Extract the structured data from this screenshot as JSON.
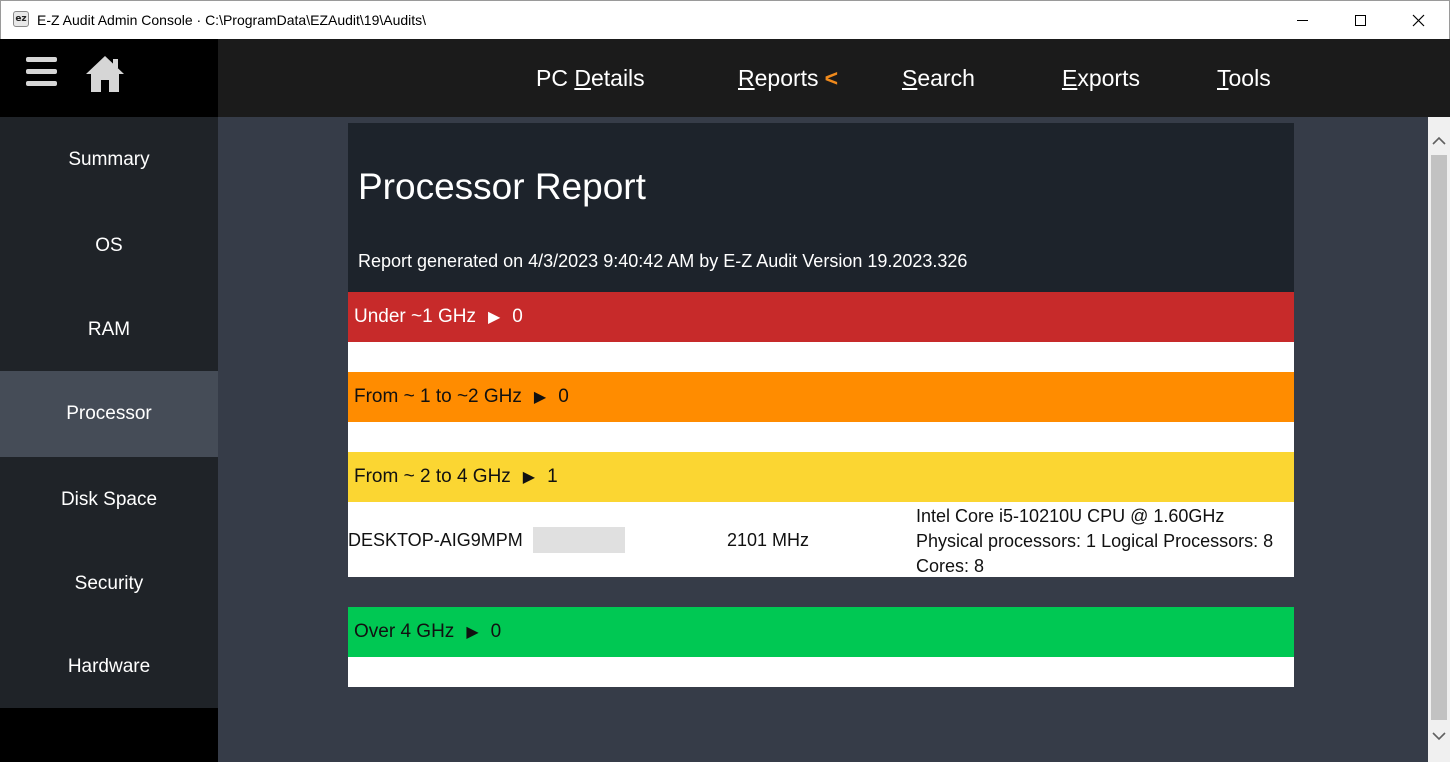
{
  "window": {
    "title": "E-Z Audit Admin Console · C:\\ProgramData\\EZAudit\\19\\Audits\\",
    "app_icon_text": "ez"
  },
  "topnav": {
    "items": [
      {
        "pre": "PC ",
        "key": "D",
        "post": "etails"
      },
      {
        "pre": "",
        "key": "R",
        "post": "eports",
        "active": true
      },
      {
        "pre": "",
        "key": "S",
        "post": "earch"
      },
      {
        "pre": "",
        "key": "E",
        "post": "xports"
      },
      {
        "pre": "",
        "key": "T",
        "post": "ools"
      }
    ],
    "active_arrow": "<",
    "accent_color": "#f08a1c"
  },
  "sidebar": {
    "items": [
      {
        "label": "Summary"
      },
      {
        "label": "OS"
      },
      {
        "label": "RAM"
      },
      {
        "label": "Processor",
        "active": true
      },
      {
        "label": "Disk Space"
      },
      {
        "label": "Security"
      },
      {
        "label": "Hardware"
      }
    ]
  },
  "report": {
    "title": "Processor Report",
    "subtitle": "Report generated on 4/3/2023 9:40:42 AM by E-Z Audit Version 19.2023.326",
    "groups": [
      {
        "label": "Under ~1 GHz",
        "count": "0",
        "color": "#c72a2a"
      },
      {
        "label": "From ~ 1 to ~2 GHz",
        "count": "0",
        "color": "#ff8c00"
      },
      {
        "label": "From ~ 2 to 4 GHz",
        "count": "1",
        "color": "#fbd632"
      },
      {
        "label": "Over 4 GHz",
        "count": "0",
        "color": "#00c853"
      }
    ],
    "row": {
      "host": "DESKTOP-AIG9MPM",
      "speed": "2101 MHz",
      "cpu": "Intel Core i5-10210U CPU @ 1.60GHz",
      "processors": "Physical processors: 1 Logical Processors: 8",
      "cores": "Cores: 8"
    },
    "arrow_glyph": "▶"
  }
}
